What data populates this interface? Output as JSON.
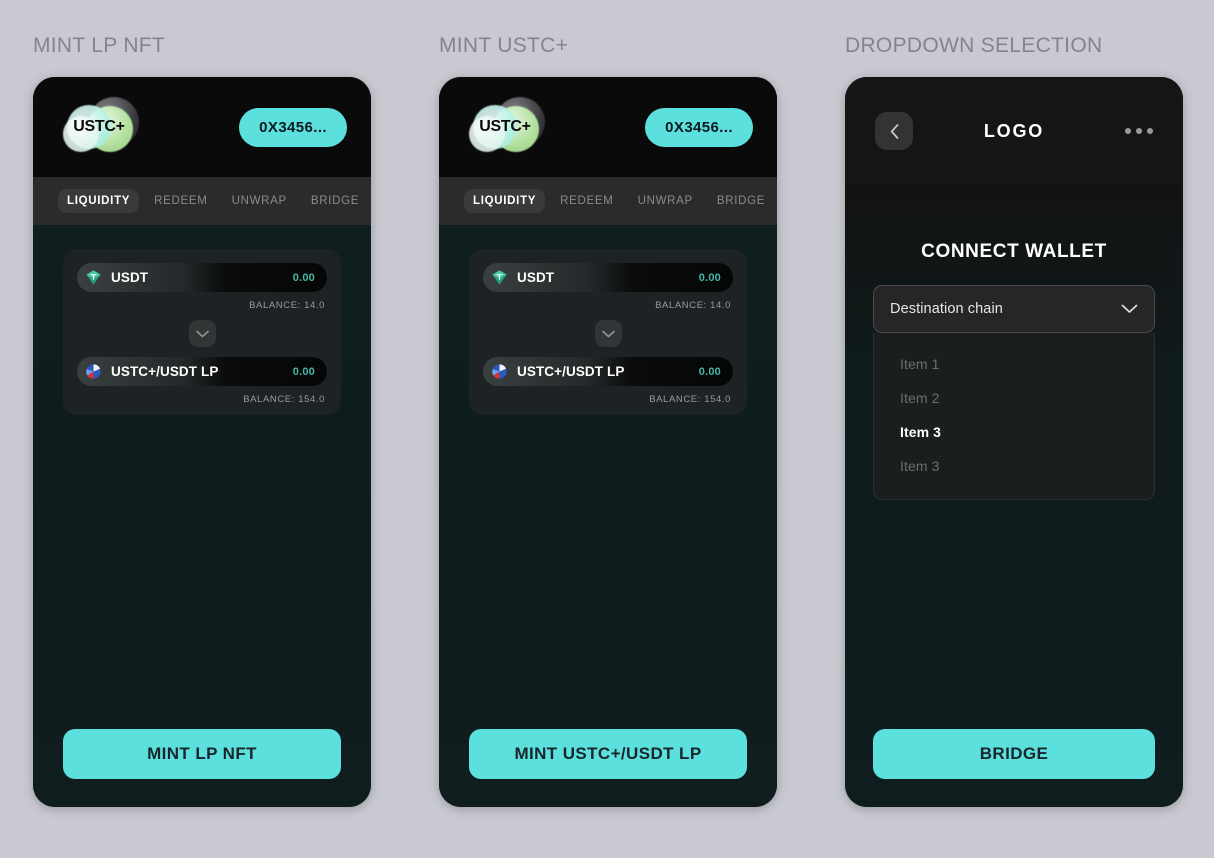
{
  "columns": [
    {
      "title": "MINT LP NFT",
      "kind": "swap",
      "header": {
        "logo_text": "USTC+",
        "logo_icon": "ustc-plus-logo",
        "address_label": "0X3456..."
      },
      "tabs": [
        {
          "label": "LIQUIDITY",
          "active": true
        },
        {
          "label": "REDEEM",
          "active": false
        },
        {
          "label": "UNWRAP",
          "active": false
        },
        {
          "label": "BRIDGE",
          "active": false
        }
      ],
      "swap": {
        "from": {
          "icon": "usdt-icon",
          "token": "USDT",
          "amount": "0.00",
          "balance": "BALANCE: 14.0"
        },
        "swap_icon": "chevron-down-icon",
        "to": {
          "icon": "lp-token-icon",
          "token": "USTC+/USDT LP",
          "amount": "0.00",
          "balance": "BALANCE: 154.0"
        }
      },
      "cta_label": "MINT LP NFT"
    },
    {
      "title": "MINT USTC+",
      "kind": "swap",
      "header": {
        "logo_text": "USTC+",
        "logo_icon": "ustc-plus-logo",
        "address_label": "0X3456..."
      },
      "tabs": [
        {
          "label": "LIQUIDITY",
          "active": true
        },
        {
          "label": "REDEEM",
          "active": false
        },
        {
          "label": "UNWRAP",
          "active": false
        },
        {
          "label": "BRIDGE",
          "active": false
        }
      ],
      "swap": {
        "from": {
          "icon": "usdt-icon",
          "token": "USDT",
          "amount": "0.00",
          "balance": "BALANCE: 14.0"
        },
        "swap_icon": "chevron-down-icon",
        "to": {
          "icon": "lp-token-icon",
          "token": "USTC+/USDT LP",
          "amount": "0.00",
          "balance": "BALANCE: 154.0"
        }
      },
      "cta_label": "MINT USTC+/USDT LP"
    },
    {
      "title": "DROPDOWN SELECTION",
      "kind": "dropdown",
      "header": {
        "back_icon": "chevron-left-icon",
        "brand": "LOGO",
        "menu_icon": "more-horizontal-icon"
      },
      "connect_title": "CONNECT WALLET",
      "select": {
        "value": "Destination chain",
        "chevron_icon": "chevron-down-icon",
        "options": [
          {
            "label": "Item 1",
            "selected": false
          },
          {
            "label": "Item 2",
            "selected": false
          },
          {
            "label": "Item 3",
            "selected": true
          },
          {
            "label": "Item 3",
            "selected": false
          }
        ]
      },
      "cta_label": "BRIDGE"
    }
  ],
  "theme": {
    "accent": "#5ce0dd",
    "page_bg": "#c9c9d1",
    "card_bg": "#0f1c1d",
    "title_color": "#84848c"
  }
}
